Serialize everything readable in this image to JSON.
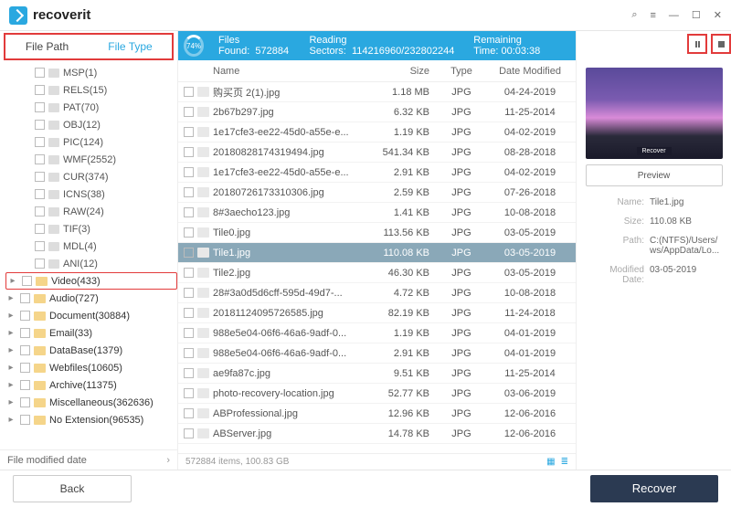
{
  "app": {
    "name": "recoverit"
  },
  "window_controls": {
    "min": "—",
    "max": "☐",
    "close": "✕",
    "search": "⌕",
    "menu": "≡"
  },
  "sidebar": {
    "tabs": {
      "path": "File Path",
      "type": "File Type"
    },
    "formats": [
      {
        "label": "MSP(1)"
      },
      {
        "label": "RELS(15)"
      },
      {
        "label": "PAT(70)"
      },
      {
        "label": "OBJ(12)"
      },
      {
        "label": "PIC(124)"
      },
      {
        "label": "WMF(2552)"
      },
      {
        "label": "CUR(374)"
      },
      {
        "label": "ICNS(38)"
      },
      {
        "label": "RAW(24)"
      },
      {
        "label": "TIF(3)"
      },
      {
        "label": "MDL(4)"
      },
      {
        "label": "ANI(12)"
      }
    ],
    "categories": [
      {
        "label": "Video(433)",
        "hl": true
      },
      {
        "label": "Audio(727)"
      },
      {
        "label": "Document(30884)"
      },
      {
        "label": "Email(33)"
      },
      {
        "label": "DataBase(1379)"
      },
      {
        "label": "Webfiles(10605)"
      },
      {
        "label": "Archive(11375)"
      },
      {
        "label": "Miscellaneous(362636)"
      },
      {
        "label": "No Extension(96535)"
      }
    ],
    "filter": "File modified date"
  },
  "status": {
    "percent": "74%",
    "found_label": "Files Found:",
    "found": "572884",
    "sectors_label": "Reading Sectors:",
    "sectors": "114216960/232802244",
    "remain_label": "Remaining Time:",
    "remain": "00:03:38"
  },
  "columns": {
    "name": "Name",
    "size": "Size",
    "type": "Type",
    "date": "Date Modified"
  },
  "rows": [
    {
      "name": "购买页 2(1).jpg",
      "size": "1.18  MB",
      "type": "JPG",
      "date": "04-24-2019"
    },
    {
      "name": "2b67b297.jpg",
      "size": "6.32  KB",
      "type": "JPG",
      "date": "11-25-2014"
    },
    {
      "name": "1e17cfe3-ee22-45d0-a55e-e...",
      "size": "1.19  KB",
      "type": "JPG",
      "date": "04-02-2019"
    },
    {
      "name": "20180828174319494.jpg",
      "size": "541.34  KB",
      "type": "JPG",
      "date": "08-28-2018"
    },
    {
      "name": "1e17cfe3-ee22-45d0-a55e-e...",
      "size": "2.91  KB",
      "type": "JPG",
      "date": "04-02-2019"
    },
    {
      "name": "20180726173310306.jpg",
      "size": "2.59  KB",
      "type": "JPG",
      "date": "07-26-2018"
    },
    {
      "name": "8#3aecho123.jpg",
      "size": "1.41  KB",
      "type": "JPG",
      "date": "10-08-2018"
    },
    {
      "name": "Tile0.jpg",
      "size": "113.56  KB",
      "type": "JPG",
      "date": "03-05-2019"
    },
    {
      "name": "Tile1.jpg",
      "size": "110.08  KB",
      "type": "JPG",
      "date": "03-05-2019",
      "sel": true
    },
    {
      "name": "Tile2.jpg",
      "size": "46.30  KB",
      "type": "JPG",
      "date": "03-05-2019"
    },
    {
      "name": "28#3a0d5d6cff-595d-49d7-...",
      "size": "4.72  KB",
      "type": "JPG",
      "date": "10-08-2018"
    },
    {
      "name": "20181124095726585.jpg",
      "size": "82.19  KB",
      "type": "JPG",
      "date": "11-24-2018"
    },
    {
      "name": "988e5e04-06f6-46a6-9adf-0...",
      "size": "1.19  KB",
      "type": "JPG",
      "date": "04-01-2019"
    },
    {
      "name": "988e5e04-06f6-46a6-9adf-0...",
      "size": "2.91  KB",
      "type": "JPG",
      "date": "04-01-2019"
    },
    {
      "name": "ae9fa87c.jpg",
      "size": "9.51  KB",
      "type": "JPG",
      "date": "11-25-2014"
    },
    {
      "name": "photo-recovery-location.jpg",
      "size": "52.77  KB",
      "type": "JPG",
      "date": "03-06-2019"
    },
    {
      "name": "ABProfessional.jpg",
      "size": "12.96  KB",
      "type": "JPG",
      "date": "12-06-2016"
    },
    {
      "name": "ABServer.jpg",
      "size": "14.78  KB",
      "type": "JPG",
      "date": "12-06-2016"
    }
  ],
  "footer_status": "572884 items, 100.83  GB",
  "preview": {
    "thumb_caption": "Recover",
    "button": "Preview",
    "labels": {
      "name": "Name:",
      "size": "Size:",
      "path": "Path:",
      "mod": "Modified Date:"
    },
    "values": {
      "name": "Tile1.jpg",
      "size": "110.08  KB",
      "path": "C:(NTFS)/Users/ws/AppData/Lo...",
      "mod": "03-05-2019"
    }
  },
  "buttons": {
    "back": "Back",
    "recover": "Recover"
  }
}
